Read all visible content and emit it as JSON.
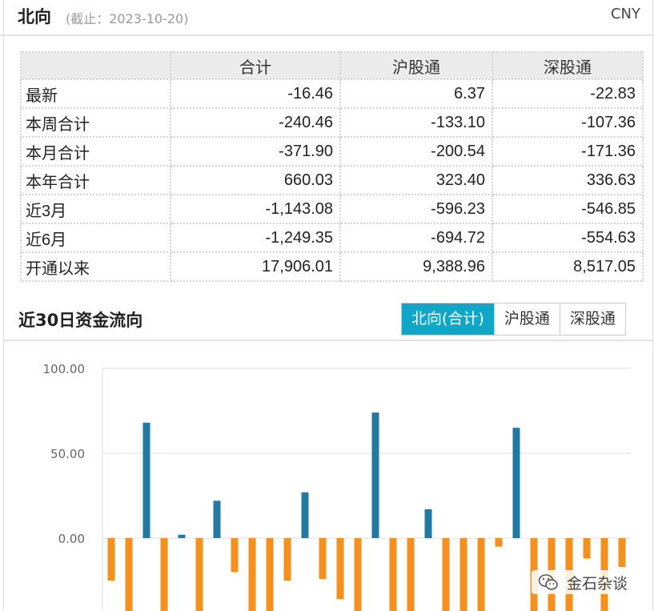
{
  "header": {
    "title": "北向",
    "date": "(截止：2023-10-20)",
    "currency": "CNY"
  },
  "table": {
    "columns": [
      "",
      "合计",
      "沪股通",
      "深股通"
    ],
    "rows": [
      {
        "label": "最新",
        "values": [
          "-16.46",
          "6.37",
          "-22.83"
        ]
      },
      {
        "label": "本周合计",
        "values": [
          "-240.46",
          "-133.10",
          "-107.36"
        ]
      },
      {
        "label": "本月合计",
        "values": [
          "-371.90",
          "-200.54",
          "-171.36"
        ]
      },
      {
        "label": "本年合计",
        "values": [
          "660.03",
          "323.40",
          "336.63"
        ]
      },
      {
        "label": "近3月",
        "values": [
          "-1,143.08",
          "-596.23",
          "-546.85"
        ]
      },
      {
        "label": "近6月",
        "values": [
          "-1,249.35",
          "-694.72",
          "-554.63"
        ]
      },
      {
        "label": "开通以来",
        "values": [
          "17,906.01",
          "9,388.96",
          "8,517.05"
        ]
      }
    ]
  },
  "section": {
    "title": "近30日资金流向",
    "tabs": [
      {
        "label": "北向(合计)",
        "active": true
      },
      {
        "label": "沪股通",
        "active": false
      },
      {
        "label": "深股通",
        "active": false
      }
    ]
  },
  "watermark": {
    "text": "金石杂谈",
    "icon": "wechat-icon"
  },
  "colors": {
    "positive": "#2479a3",
    "negative": "#f5901e",
    "accent": "#10a6c8"
  },
  "chart_data": {
    "type": "bar",
    "y_ticks": [
      "100.00",
      "50.00",
      "0.00"
    ],
    "ylim": [
      -39,
      100
    ],
    "grid": true,
    "values": [
      -25,
      -45,
      68,
      -45,
      2,
      -45,
      22,
      -20,
      -45,
      -45,
      -25,
      27,
      -24,
      -36,
      -45,
      74,
      -45,
      -45,
      17,
      -45,
      -45,
      -45,
      -5,
      65,
      -45,
      -45,
      -45,
      -12,
      -45,
      -17
    ]
  }
}
